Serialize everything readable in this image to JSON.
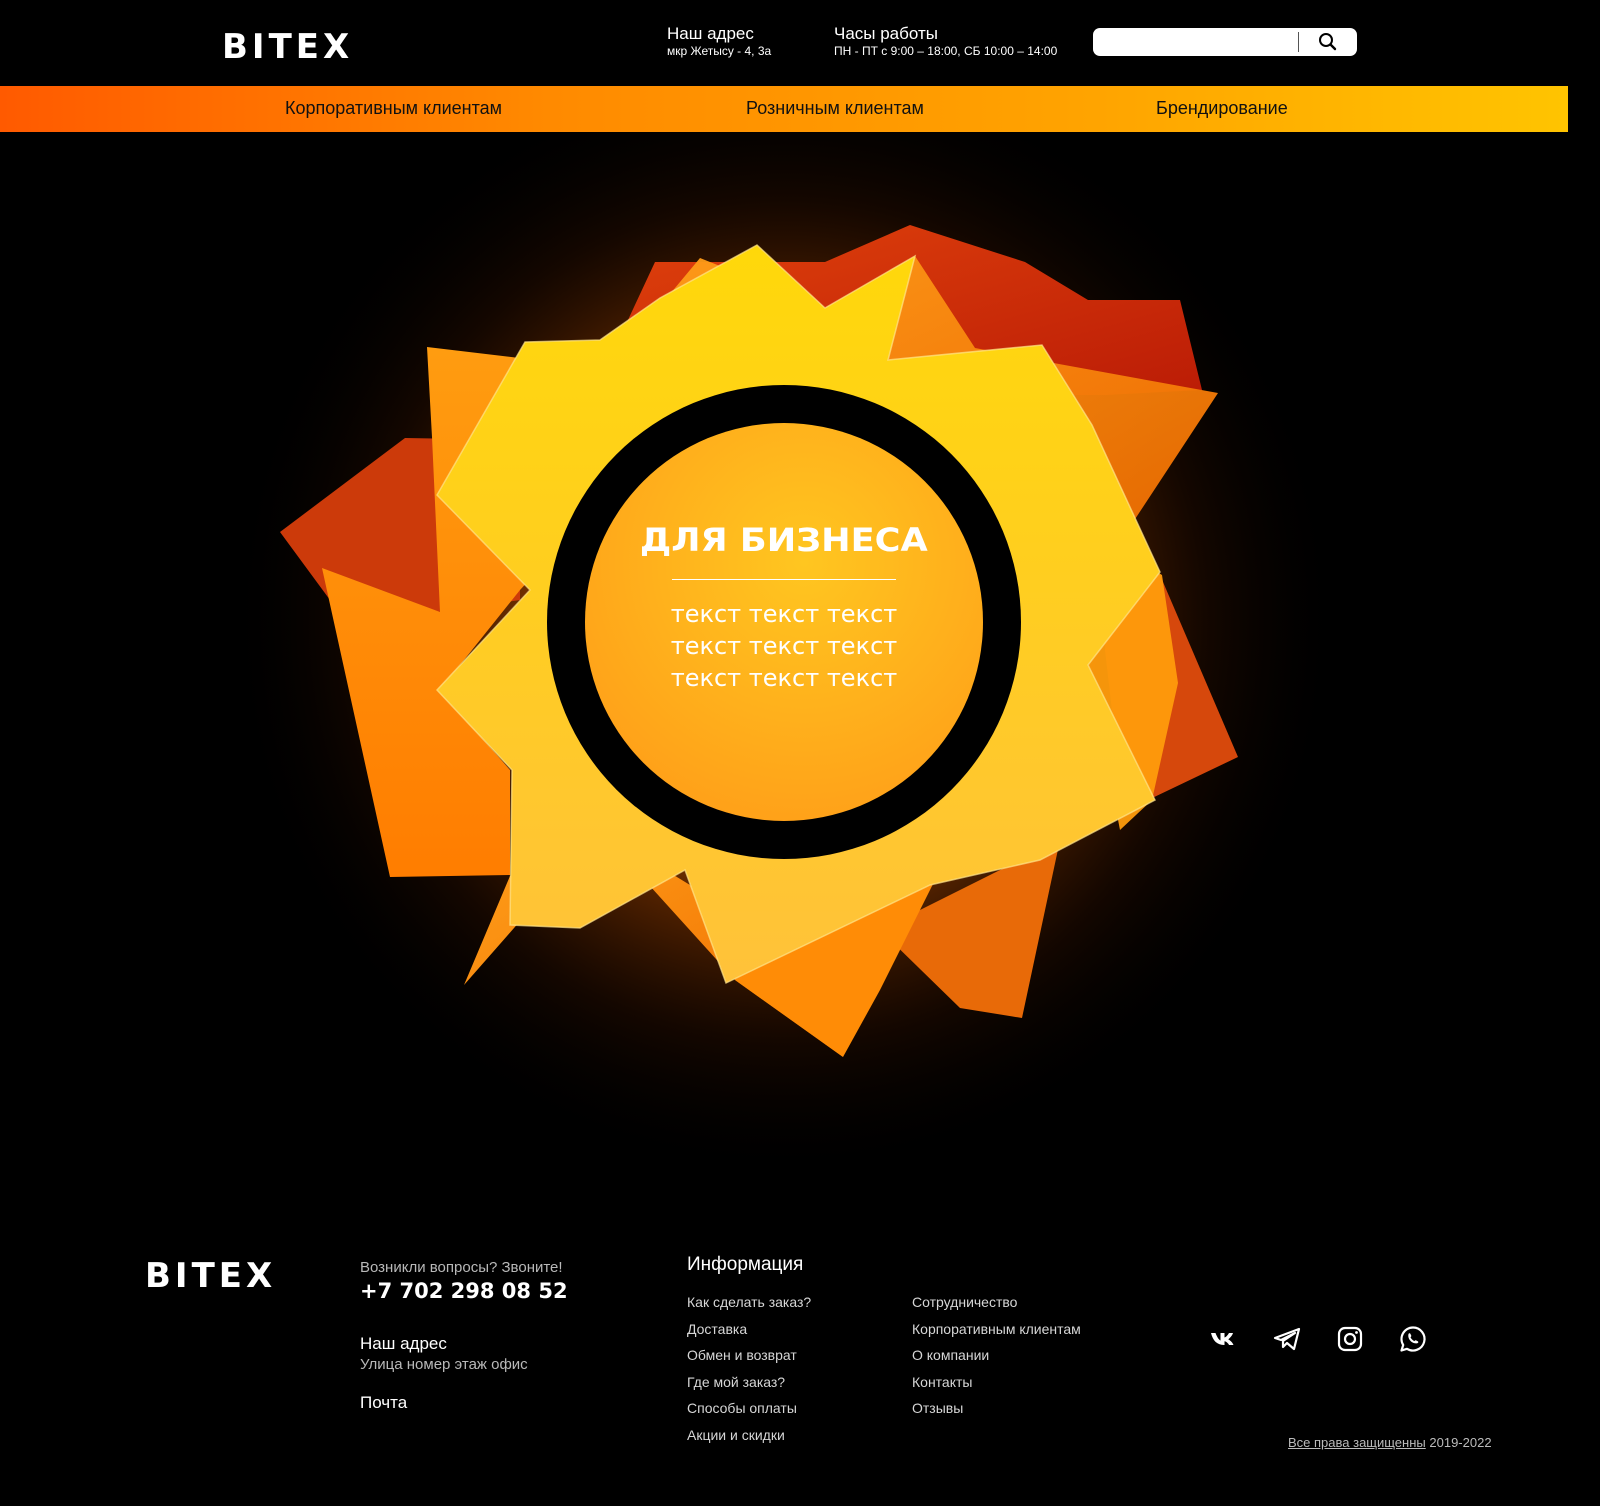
{
  "header": {
    "logo": "BITEX",
    "address_title": "Наш адрес",
    "address_value": "мкр Жетысу - 4, 3а",
    "hours_title": "Часы работы",
    "hours_value": "ПН - ПТ с 9:00 – 18:00,  СБ 10:00 – 14:00",
    "search_placeholder": "",
    "search_icon": "search-icon"
  },
  "nav": {
    "items": [
      "Корпоративным клиентам",
      "Розничным клиентам",
      "Брендирование"
    ]
  },
  "hero": {
    "title": "ДЛЯ БИЗНЕСА",
    "lines": [
      "текст текст текст",
      "текст текст текст",
      "текст текст текст"
    ]
  },
  "footer": {
    "logo": "BITEX",
    "question": "Возникли вопросы? Звоните!",
    "phone": "+7 702 298 08 52",
    "address_title": "Наш адрес",
    "address_value": "Улица номер этаж офис",
    "mail_title": "Почта",
    "info_title": "Информация",
    "links_col1": [
      "Как сделать заказ?",
      "Доставка",
      "Обмен и возврат",
      "Где мой заказ?",
      "Способы оплаты",
      "Акции и скидки"
    ],
    "links_col2": [
      "Сотрудничество",
      "Корпоративным клиентам",
      "О компании",
      "Контакты",
      "Отзывы"
    ],
    "socials": [
      "vk-icon",
      "telegram-icon",
      "instagram-icon",
      "whatsapp-icon"
    ],
    "rights": "Все права защищенны",
    "years": "2019-2022"
  },
  "colors": {
    "nav_gradient_start": "#ff5a00",
    "nav_gradient_end": "#ffc400",
    "accent_yellow": "#ffd200",
    "accent_red": "#c62a0c"
  }
}
